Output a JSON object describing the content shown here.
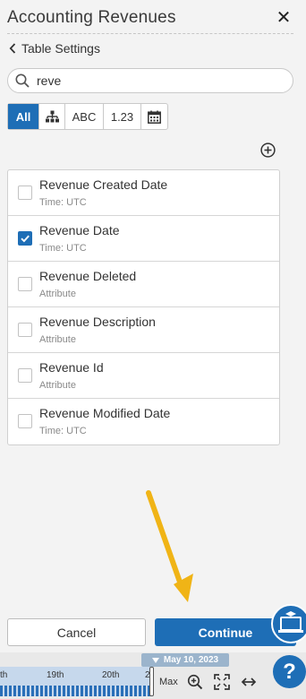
{
  "header": {
    "title": "Accounting Revenues",
    "close_icon": "close-icon"
  },
  "nav": {
    "back_label": "Table Settings"
  },
  "search": {
    "value": "reve",
    "placeholder": ""
  },
  "filters": [
    {
      "label": "All",
      "active": true
    },
    {
      "label": "",
      "icon": "hierarchy-icon"
    },
    {
      "label": "ABC"
    },
    {
      "label": "1.23"
    },
    {
      "label": "",
      "icon": "calendar-icon"
    }
  ],
  "columns": [
    {
      "name": "Revenue Created Date",
      "type": "Time: UTC",
      "checked": false
    },
    {
      "name": "Revenue Date",
      "type": "Time: UTC",
      "checked": true
    },
    {
      "name": "Revenue Deleted",
      "type": "Attribute",
      "checked": false
    },
    {
      "name": "Revenue Description",
      "type": "Attribute",
      "checked": false
    },
    {
      "name": "Revenue Id",
      "type": "Attribute",
      "checked": false
    },
    {
      "name": "Revenue Modified Date",
      "type": "Time: UTC",
      "checked": false
    }
  ],
  "actions": {
    "cancel": "Cancel",
    "continue": "Continue"
  },
  "timeline": {
    "labels": [
      "th",
      "19th",
      "20th",
      "2"
    ],
    "date": "May 10, 2023",
    "max_label": "Max"
  },
  "help": {
    "label": "?"
  },
  "colors": {
    "accent": "#1e6eb6",
    "arrow": "#f0b416",
    "background": "#f3f3f3"
  }
}
